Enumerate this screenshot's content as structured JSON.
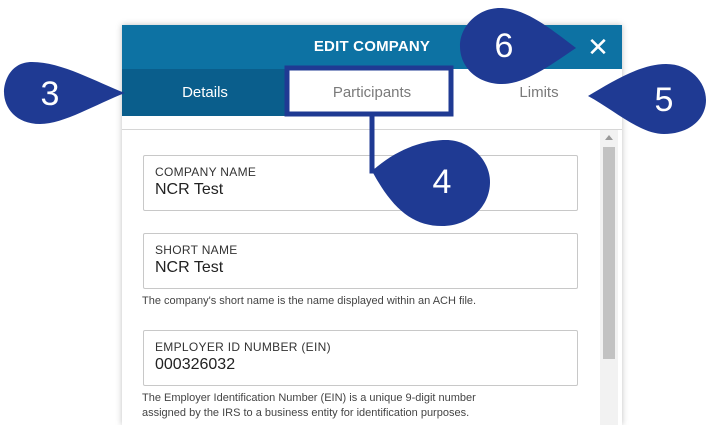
{
  "modal": {
    "title": "EDIT COMPANY",
    "close_icon": "close-icon"
  },
  "tabs": [
    {
      "label": "Details",
      "active": true
    },
    {
      "label": "Participants",
      "active": false
    },
    {
      "label": "Limits",
      "active": false
    }
  ],
  "fields": [
    {
      "label": "COMPANY NAME",
      "value": "NCR Test"
    },
    {
      "label": "SHORT NAME",
      "value": "NCR Test",
      "help": "The company's short name is the name displayed within an ACH file."
    },
    {
      "label": "EMPLOYER ID NUMBER (EIN)",
      "value": "000326032",
      "help_line1": "The Employer Identification Number (EIN) is a unique 9-digit number",
      "help_line2": "assigned by the IRS to a business entity for identification purposes."
    }
  ],
  "callouts": {
    "c3": "3",
    "c4": "4",
    "c5": "5",
    "c6": "6"
  },
  "colors": {
    "header": "#0d72a3",
    "active_tab": "#0a5e8c",
    "callout": "#1f3a93",
    "highlight_border": "#1f3a93"
  }
}
